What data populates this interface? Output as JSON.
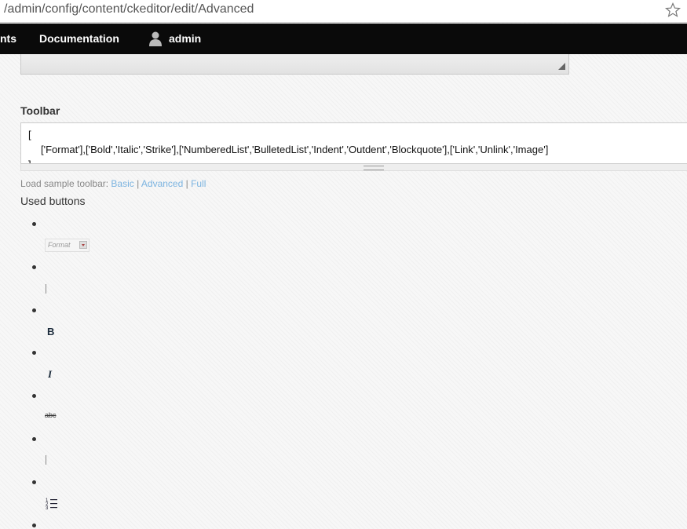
{
  "browser": {
    "url": "/admin/config/content/ckeditor/edit/Advanced",
    "bookmark_icon": "star-icon"
  },
  "topbar": {
    "items": [
      {
        "label": "nts"
      },
      {
        "label": "Documentation"
      },
      {
        "label": "admin"
      }
    ],
    "user_icon": "user-icon"
  },
  "toolbar_field": {
    "label": "Toolbar",
    "value_lines": [
      "[",
      "['Format'],['Bold','Italic','Strike'],['NumberedList','BulletedList','Indent','Outdent','Blockquote'],['Link','Unlink','Image']",
      "]"
    ]
  },
  "sample_toolbar": {
    "prefix": "Load sample toolbar:",
    "links": [
      "Basic",
      "Advanced",
      "Full"
    ],
    "separator": "|"
  },
  "used_buttons": {
    "title": "Used buttons",
    "items": [
      {
        "name": "format-dropdown",
        "text": "Format"
      },
      {
        "name": "separator"
      },
      {
        "name": "bold-icon",
        "text": "B"
      },
      {
        "name": "italic-icon",
        "text": "I"
      },
      {
        "name": "strike-icon",
        "text": "abc"
      },
      {
        "name": "separator"
      },
      {
        "name": "numbered-list-icon"
      },
      {
        "name": "list-item"
      }
    ]
  }
}
